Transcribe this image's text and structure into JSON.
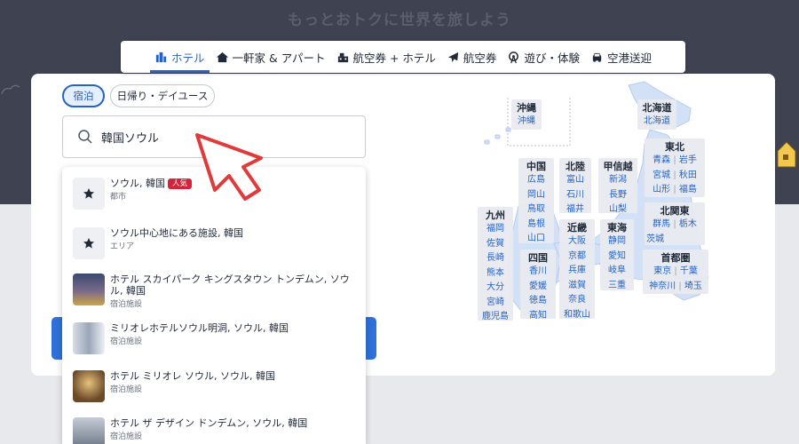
{
  "hero": {
    "title": "もっとおトクに世界を旅しよう"
  },
  "tabs": [
    {
      "label": "ホテル",
      "icon": "hotel-icon",
      "active": true
    },
    {
      "label": "一軒家 & アパート",
      "icon": "house-icon",
      "active": false
    },
    {
      "label": "航空券 + ホテル",
      "icon": "flight-hotel-icon",
      "active": false
    },
    {
      "label": "航空券",
      "icon": "airplane-icon",
      "active": false
    },
    {
      "label": "遊び・体験",
      "icon": "ferris-wheel-icon",
      "active": false
    },
    {
      "label": "空港送迎",
      "icon": "car-icon",
      "active": false
    }
  ],
  "booking_type": {
    "stay": "宿泊",
    "day_use": "日帰り・デイユース"
  },
  "search": {
    "value": "韓国ソウル",
    "icon": "search-icon"
  },
  "suggestions": [
    {
      "title": "ソウル, 韓国",
      "badge": "人気",
      "sub": "都市",
      "icon": "star-icon"
    },
    {
      "title": "ソウル中心地にある施設, 韓国",
      "sub": "エリア",
      "icon": "star-icon"
    },
    {
      "title": "ホテル スカイパーク キングスタウン トンデムン, ソウル, 韓国",
      "sub": "宿泊施設",
      "icon": "hotel-photo"
    },
    {
      "title": "ミリオレホテルソウル明洞, ソウル, 韓国",
      "sub": "宿泊施設",
      "icon": "hotel-photo"
    },
    {
      "title": "ホテル ミリオレ ソウル, ソウル, 韓国",
      "sub": "宿泊施設",
      "icon": "hotel-photo"
    },
    {
      "title": "ホテル ザ デザイン ドンデムン, ソウル, 韓国",
      "sub": "宿泊施設",
      "icon": "hotel-photo"
    }
  ],
  "map": {
    "regions": {
      "okinawa": {
        "name": "沖縄",
        "prefs": [
          "沖縄"
        ]
      },
      "hokkaido": {
        "name": "北海道",
        "prefs": [
          "北海道"
        ]
      },
      "tohoku": {
        "name": "東北",
        "prefs": [
          [
            "青森",
            "岩手"
          ],
          [
            "宮城",
            "秋田"
          ],
          [
            "山形",
            "福島"
          ]
        ]
      },
      "chugoku": {
        "name": "中国",
        "prefs": [
          "広島",
          "岡山",
          "鳥取",
          "島根",
          "山口"
        ]
      },
      "hokuriku": {
        "name": "北陸",
        "prefs": [
          "富山",
          "石川",
          "福井"
        ]
      },
      "koshinetsu": {
        "name": "甲信越",
        "prefs": [
          "新潟",
          "長野",
          "山梨"
        ]
      },
      "kitakanto": {
        "name": "北関東",
        "prefs": [
          [
            "群馬",
            "栃木"
          ],
          [
            "茨城"
          ]
        ]
      },
      "kyushu": {
        "name": "九州",
        "prefs": [
          "福岡",
          "佐賀",
          "長崎",
          "熊本",
          "大分",
          "宮崎",
          "鹿児島"
        ]
      },
      "kinki": {
        "name": "近畿",
        "prefs": [
          "大阪",
          "京都",
          "兵庫",
          "滋賀",
          "奈良",
          "和歌山"
        ]
      },
      "tokai": {
        "name": "東海",
        "prefs": [
          "静岡",
          "愛知",
          "岐阜",
          "三重"
        ]
      },
      "shikoku": {
        "name": "四国",
        "prefs": [
          "香川",
          "愛媛",
          "徳島",
          "高知"
        ]
      },
      "shutoken": {
        "name": "首都圏",
        "prefs": [
          [
            "東京",
            "千葉"
          ],
          [
            "神奈川",
            "埼玉"
          ]
        ]
      }
    }
  },
  "colors": {
    "accent": "#2563c7",
    "badge": "#d3243b",
    "hero_bg": "#3f4251"
  }
}
